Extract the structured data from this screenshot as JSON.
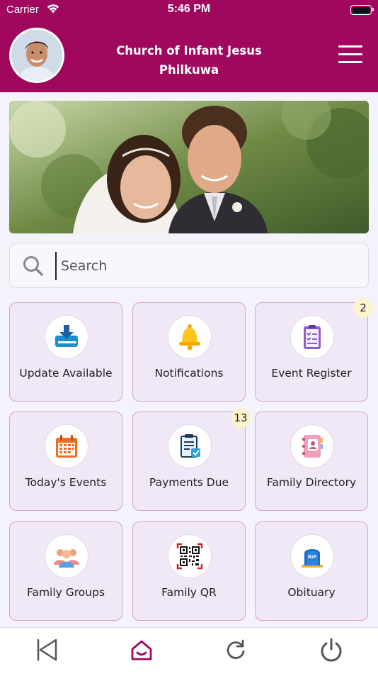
{
  "status_bar": {
    "carrier": "Carrier",
    "time": "5:46 PM",
    "wifi_icon": "wifi-icon",
    "battery_icon": "battery-icon"
  },
  "header": {
    "title_line1": "Church of Infant Jesus",
    "title_line2": "Philkuwa",
    "avatar_icon": "avatar",
    "menu_icon": "hamburger-menu-icon",
    "background_color": "#a0085e"
  },
  "banner": {
    "image": "wedding-couple-photo"
  },
  "search": {
    "placeholder": "Search",
    "icon": "search-icon"
  },
  "tiles": [
    {
      "label": "Update Available",
      "icon": "download-icon",
      "badge": ""
    },
    {
      "label": "Notifications",
      "icon": "bell-icon",
      "badge": ""
    },
    {
      "label": "Event Register",
      "icon": "clipboard-checklist-icon",
      "badge": "2"
    },
    {
      "label": "Today's Events",
      "icon": "calendar-icon",
      "badge": ""
    },
    {
      "label": "Payments Due",
      "icon": "bill-icon",
      "badge": "13"
    },
    {
      "label": "Family Directory",
      "icon": "address-book-icon",
      "badge": ""
    },
    {
      "label": "Family Groups",
      "icon": "group-icon",
      "badge": ""
    },
    {
      "label": "Family QR",
      "icon": "qr-code-icon",
      "badge": ""
    },
    {
      "label": "Obituary",
      "icon": "tombstone-icon",
      "badge": ""
    }
  ],
  "bottom_nav": {
    "items": [
      "back-icon",
      "home-icon",
      "refresh-icon",
      "power-icon"
    ],
    "active": "home-icon",
    "active_color": "#a0085e"
  }
}
